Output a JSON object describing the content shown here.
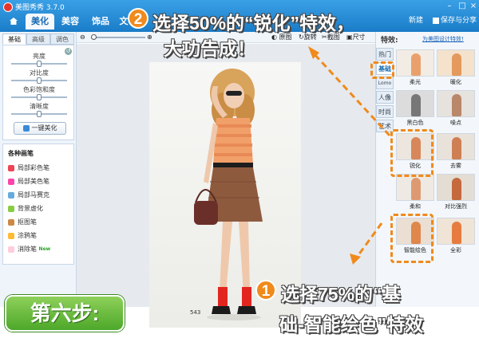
{
  "app": {
    "title": "美图秀秀 3.7.0"
  },
  "tabs": [
    "美化",
    "美容",
    "饰品",
    "文"
  ],
  "titlebar_right": {
    "new_label": "新建",
    "save_label": "保存与分享"
  },
  "left_panel": {
    "subtabs": [
      "基础",
      "高级",
      "调色"
    ],
    "adjustments": [
      {
        "label": "亮度",
        "value": 0.5
      },
      {
        "label": "对比度",
        "value": 0.5
      },
      {
        "label": "色彩饱和度",
        "value": 0.5
      },
      {
        "label": "清晰度",
        "value": 0.5
      }
    ],
    "one_key_label": "一键美化",
    "brushes_title": "各种画笔",
    "brushes": [
      "局部彩色笔",
      "局部美色笔",
      "局部马赛克",
      "背景虚化",
      "抠图笔",
      "涂鸦笔",
      "消除笔"
    ],
    "new_badge": "New"
  },
  "toolbar": {
    "original_label": "原图",
    "rotate_label": "旋转",
    "crop_label": "截图",
    "size_label": "尺寸",
    "zoom": 0.0
  },
  "canvas": {
    "photo_size": "543"
  },
  "right_panel": {
    "title": "特效:",
    "link": "为美图设计特效!",
    "categories": [
      "热门",
      "基础",
      "Lomo",
      "人像",
      "时尚",
      "艺术"
    ],
    "effects": [
      "柔光",
      "暖化",
      "黑白色",
      "噪点",
      "锐化",
      "去雾",
      "柔和",
      "对比强烈",
      "智能绘色",
      "全彩"
    ]
  },
  "annotations": {
    "step2_line1": "选择50%的“锐化”特效，",
    "step2_line2": "大功告成！",
    "step1_line1": "选择75%的“基",
    "step1_line2": "础-智能绘色”特效",
    "step_badge": "第六步:",
    "num1": "1",
    "num2": "2"
  },
  "colors": {
    "accent": "#f08a1c",
    "titlebar": "#1a7cc8",
    "step_green": "#4da82a"
  }
}
